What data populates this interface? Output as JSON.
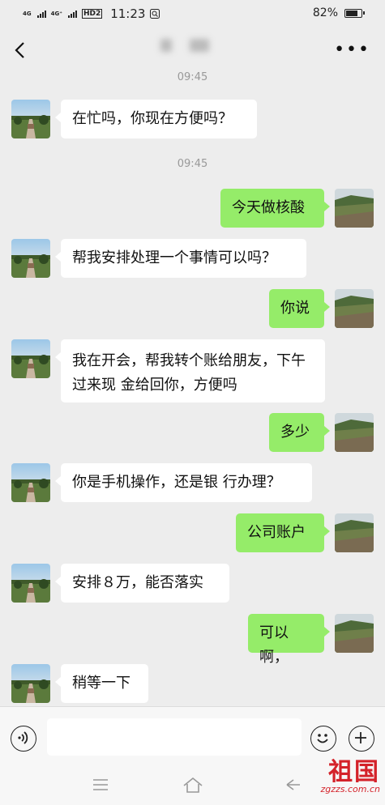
{
  "status": {
    "signal1": "4G",
    "signal2": "4G⁺",
    "hd": "HD2",
    "time": "11:23",
    "battery": "82%",
    "battery_level": 0.82
  },
  "chat": {
    "timestamps": [
      "09:45",
      "09:45"
    ],
    "messages": [
      {
        "side": "in",
        "text": "在忙吗，你现在方便吗？"
      },
      {
        "side": "out",
        "text": "今天做核酸"
      },
      {
        "side": "in",
        "text": "帮我安排处理一个事情可以吗？"
      },
      {
        "side": "out",
        "text": "你说"
      },
      {
        "side": "in",
        "text": "我在开会，帮我转个账给朋友，下午过来现 金给回你，方便吗"
      },
      {
        "side": "out",
        "text": "多少"
      },
      {
        "side": "in",
        "text": "你是手机操作，还是银 行办理？"
      },
      {
        "side": "out",
        "text": "公司账户"
      },
      {
        "side": "in",
        "text": "安排８万，能否落实"
      },
      {
        "side": "out",
        "text": "可以啊，"
      },
      {
        "side": "in",
        "text": "稍等一下"
      }
    ]
  },
  "watermark": {
    "brand": "祖国",
    "url": "zgzzs.com.cn"
  },
  "colors": {
    "out_bubble": "#95ec69",
    "in_bubble": "#ffffff",
    "background": "#ededed"
  }
}
